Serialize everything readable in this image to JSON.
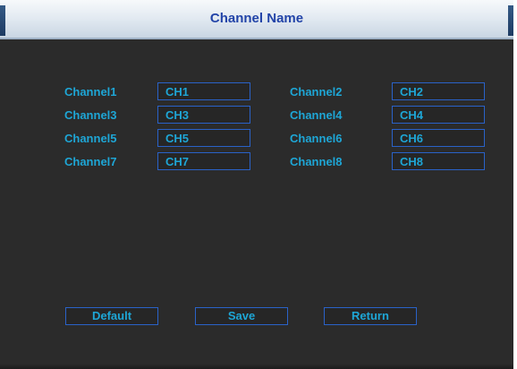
{
  "window": {
    "title": "Channel Name"
  },
  "channels": [
    {
      "label": "Channel1",
      "value": "CH1"
    },
    {
      "label": "Channel2",
      "value": "CH2"
    },
    {
      "label": "Channel3",
      "value": "CH3"
    },
    {
      "label": "Channel4",
      "value": "CH4"
    },
    {
      "label": "Channel5",
      "value": "CH5"
    },
    {
      "label": "Channel6",
      "value": "CH6"
    },
    {
      "label": "Channel7",
      "value": "CH7"
    },
    {
      "label": "Channel8",
      "value": "CH8"
    }
  ],
  "buttons": {
    "default": "Default",
    "save": "Save",
    "return": "Return"
  },
  "colors": {
    "background": "#2b2b2b",
    "text_accent": "#1ea6d6",
    "field_border": "#2a62c8",
    "title_text": "#2244a8"
  }
}
